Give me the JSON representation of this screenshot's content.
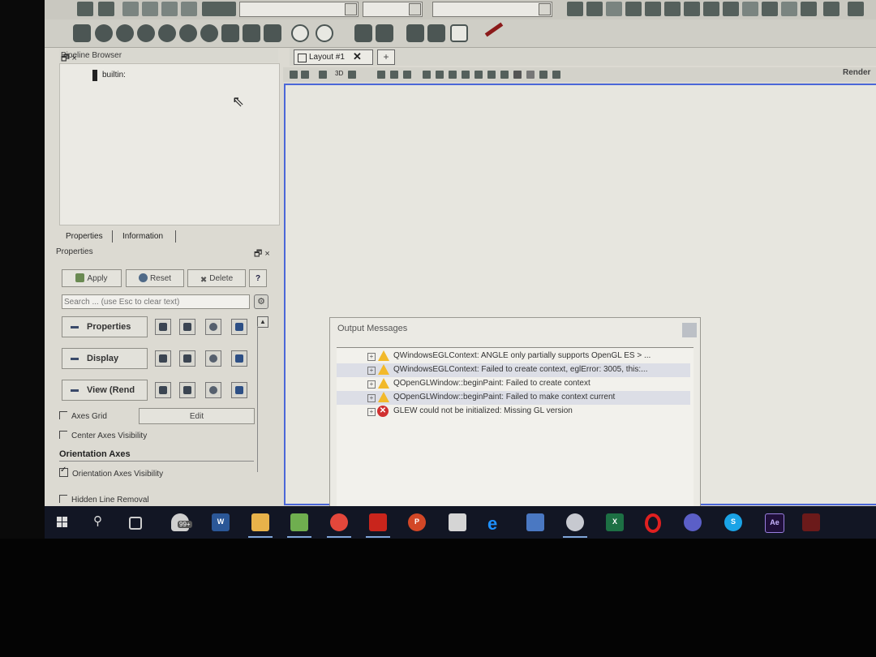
{
  "pipeline_browser": {
    "title": "Pipeline Browser",
    "float_close": "🗗 ×",
    "item": "builtin:"
  },
  "properties_panel": {
    "tabs": [
      "Properties",
      "Information"
    ],
    "title": "Properties",
    "float_close": "🗗 ×",
    "buttons": {
      "apply": "Apply",
      "reset": "Reset",
      "delete": "Delete",
      "help": "?"
    },
    "search_placeholder": "Search ... (use Esc to clear text)",
    "sections": [
      "Properties",
      "Display",
      "View (Rend"
    ],
    "axes_grid": {
      "label": "Axes Grid",
      "checked": false,
      "edit": "Edit"
    },
    "center_axes_visibility": {
      "label": "Center Axes Visibility",
      "checked": false
    },
    "orientation_axes_header": "Orientation Axes",
    "orientation_axes_visibility": {
      "label": "Orientation Axes Visibility",
      "checked": true
    },
    "hidden_line_removal": {
      "label": "Hidden Line Removal",
      "checked": false
    }
  },
  "layout": {
    "tab_label": "Layout #1",
    "tab_close": "✕",
    "add_tab": "+",
    "view_mode": "3D",
    "render_label": "Render"
  },
  "output_messages": {
    "title": "Output Messages",
    "messages": [
      {
        "type": "warning",
        "text": "QWindowsEGLContext: ANGLE only partially supports OpenGL ES > ..."
      },
      {
        "type": "warning",
        "text": "QWindowsEGLContext: Failed to create context, eglError: 3005, this:..."
      },
      {
        "type": "warning",
        "text": "QOpenGLWindow::beginPaint: Failed to create context"
      },
      {
        "type": "warning",
        "text": "QOpenGLWindow::beginPaint: Failed to make context current"
      },
      {
        "type": "error",
        "text": "GLEW could not be initialized: Missing GL version"
      }
    ]
  },
  "taskbar": {
    "notification_badge": "99+",
    "apps": [
      "start-icon",
      "search-icon",
      "task-view-icon",
      "graduation-cap-icon",
      "word-icon",
      "file-explorer-icon",
      "notepad-icon",
      "chrome-icon",
      "acrobat-icon",
      "powerpoint-icon",
      "calculator-icon",
      "edge-icon",
      "book-icon",
      "paraview-icon",
      "excel-icon",
      "opera-icon",
      "teams-icon",
      "skype-icon",
      "after-effects-icon",
      "red-app-icon"
    ],
    "labels": {
      "word": "W",
      "excel": "X",
      "skype": "S",
      "after_effects": "Ae",
      "powerpoint": "P"
    }
  },
  "colors": {
    "render_border": "#4b67d8",
    "warning": "#f2b92a",
    "error": "#d03030",
    "taskbar": "#121624"
  }
}
